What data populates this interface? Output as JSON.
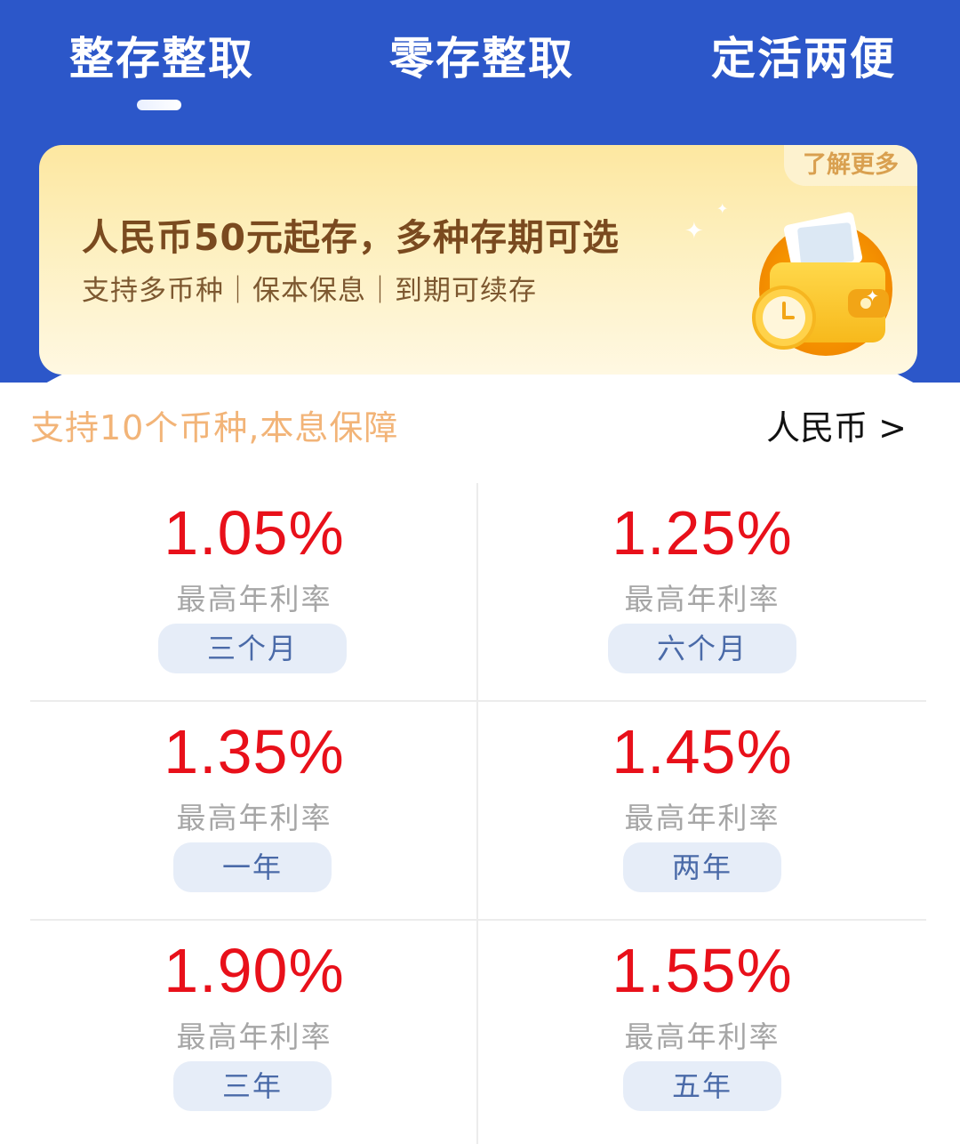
{
  "tabs": [
    {
      "label": "整存整取",
      "active": true
    },
    {
      "label": "零存整取",
      "active": false
    },
    {
      "label": "定活两便",
      "active": false
    }
  ],
  "banner": {
    "tag": "了解更多",
    "title": "人民币50元起存，多种存期可选",
    "subtitle": "支持多币种｜保本保息｜到期可续存"
  },
  "support": {
    "text": "支持10个币种,本息保障",
    "currency": "人民币 >"
  },
  "rates": [
    {
      "rate": "1.05%",
      "label": "最高年利率",
      "term": "三个月"
    },
    {
      "rate": "1.25%",
      "label": "最高年利率",
      "term": "六个月"
    },
    {
      "rate": "1.35%",
      "label": "最高年利率",
      "term": "一年"
    },
    {
      "rate": "1.45%",
      "label": "最高年利率",
      "term": "两年"
    },
    {
      "rate": "1.90%",
      "label": "最高年利率",
      "term": "三年"
    },
    {
      "rate": "1.55%",
      "label": "最高年利率",
      "term": "五年"
    }
  ],
  "colors": {
    "header_blue": "#2c57c9",
    "rate_red": "#e8101a",
    "support_orange": "#f2b478",
    "term_bg": "#e6edf8"
  }
}
